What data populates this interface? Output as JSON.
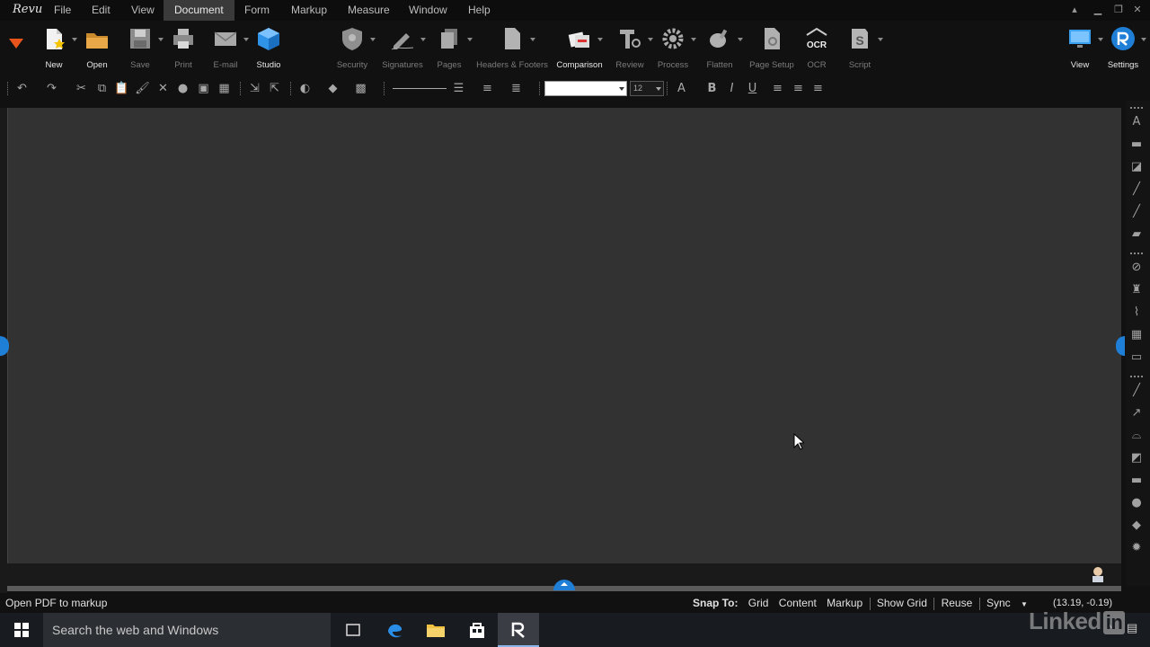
{
  "app": {
    "logo_text": "Revu"
  },
  "menu": {
    "items": [
      "File",
      "Edit",
      "View",
      "Document",
      "Form",
      "Markup",
      "Measure",
      "Window",
      "Help"
    ],
    "active": "Document"
  },
  "ribbon": {
    "new": "New",
    "open": "Open",
    "save": "Save",
    "print": "Print",
    "email": "E-mail",
    "studio": "Studio",
    "security": "Security",
    "signatures": "Signatures",
    "pages": "Pages",
    "headers_footers": "Headers & Footers",
    "comparison": "Comparison",
    "review": "Review",
    "process": "Process",
    "flatten": "Flatten",
    "page_setup": "Page Setup",
    "ocr": "OCR",
    "ocr_badge": "OCR",
    "script": "Script",
    "view": "View",
    "settings": "Settings"
  },
  "toolbar": {
    "font_size": "12",
    "font_name": ""
  },
  "status": {
    "message": "Open PDF to markup",
    "snap_to_label": "Snap To:",
    "grid": "Grid",
    "content": "Content",
    "markup": "Markup",
    "show_grid": "Show Grid",
    "reuse": "Reuse",
    "sync": "Sync",
    "coordinates": "(13.19, -0.19)"
  },
  "taskbar": {
    "search_placeholder": "Search the web and Windows"
  },
  "watermark": {
    "text": "Linked",
    "badge": "in"
  },
  "colors": {
    "accent_blue": "#1f7fd6",
    "canvas": "#323232",
    "chrome": "#111111",
    "taskbar": "#181b1f"
  }
}
